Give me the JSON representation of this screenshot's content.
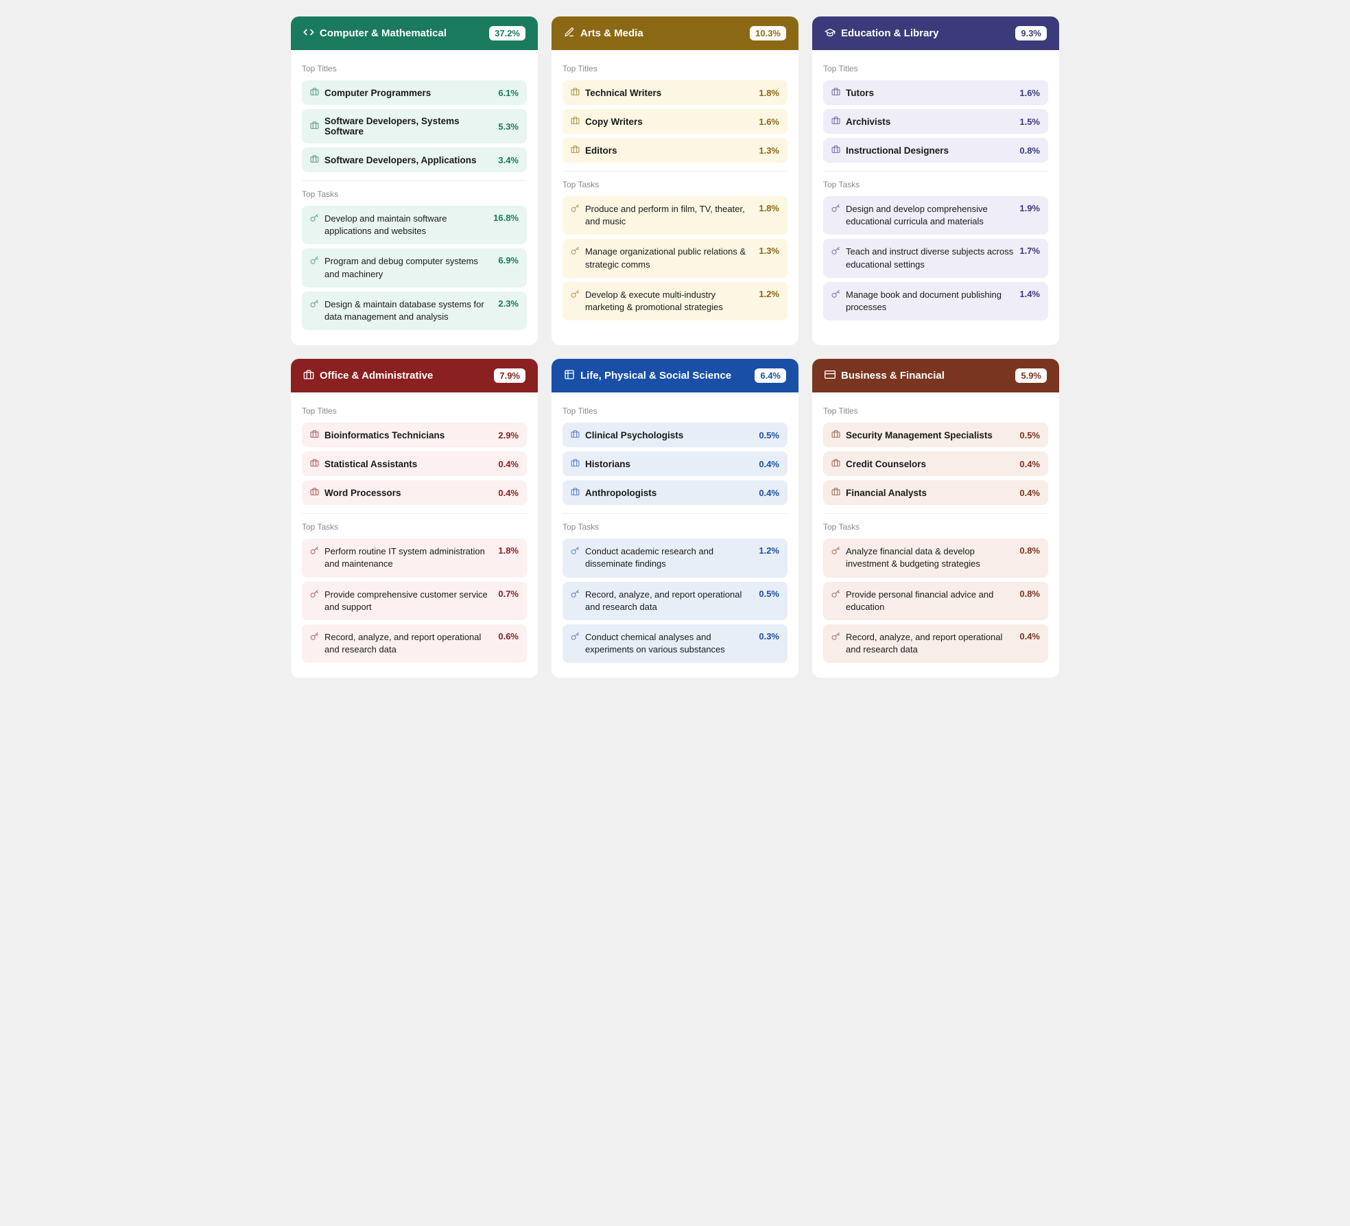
{
  "cards": [
    {
      "id": "computer-mathematical",
      "icon": "</>",
      "title": "Computer & Mathematical",
      "percentage": "37.2%",
      "colorTheme": "green",
      "titles": [
        {
          "name": "Computer Programmers",
          "pct": "6.1%"
        },
        {
          "name": "Software Developers, Systems Software",
          "pct": "5.3%"
        },
        {
          "name": "Software Developers, Applications",
          "pct": "3.4%"
        }
      ],
      "tasks": [
        {
          "text": "Develop and maintain software applications and websites",
          "pct": "16.8%"
        },
        {
          "text": "Program and debug computer systems and machinery",
          "pct": "6.9%"
        },
        {
          "text": "Design & maintain database systems for data management and analysis",
          "pct": "2.3%"
        }
      ]
    },
    {
      "id": "arts-media",
      "icon": "🎨",
      "title": "Arts & Media",
      "percentage": "10.3%",
      "colorTheme": "gold",
      "titles": [
        {
          "name": "Technical Writers",
          "pct": "1.8%"
        },
        {
          "name": "Copy Writers",
          "pct": "1.6%"
        },
        {
          "name": "Editors",
          "pct": "1.3%"
        }
      ],
      "tasks": [
        {
          "text": "Produce and perform in film, TV, theater, and music",
          "pct": "1.8%"
        },
        {
          "text": "Manage organizational public relations & strategic comms",
          "pct": "1.3%"
        },
        {
          "text": "Develop & execute multi-industry marketing & promotional strategies",
          "pct": "1.2%"
        }
      ]
    },
    {
      "id": "education-library",
      "icon": "🎓",
      "title": "Education & Library",
      "percentage": "9.3%",
      "colorTheme": "purple",
      "titles": [
        {
          "name": "Tutors",
          "pct": "1.6%"
        },
        {
          "name": "Archivists",
          "pct": "1.5%"
        },
        {
          "name": "Instructional Designers",
          "pct": "0.8%"
        }
      ],
      "tasks": [
        {
          "text": "Design and develop comprehensive educational curricula and materials",
          "pct": "1.9%"
        },
        {
          "text": "Teach and instruct diverse subjects across educational settings",
          "pct": "1.7%"
        },
        {
          "text": "Manage book and document publishing processes",
          "pct": "1.4%"
        }
      ]
    },
    {
      "id": "office-administrative",
      "icon": "🏢",
      "title": "Office & Administrative",
      "percentage": "7.9%",
      "colorTheme": "red",
      "titles": [
        {
          "name": "Bioinformatics Technicians",
          "pct": "2.9%"
        },
        {
          "name": "Statistical Assistants",
          "pct": "0.4%"
        },
        {
          "name": "Word Processors",
          "pct": "0.4%"
        }
      ],
      "tasks": [
        {
          "text": "Perform routine IT system administration and maintenance",
          "pct": "1.8%"
        },
        {
          "text": "Provide comprehensive customer service and support",
          "pct": "0.7%"
        },
        {
          "text": "Record, analyze, and report operational and research data",
          "pct": "0.6%"
        }
      ]
    },
    {
      "id": "life-physical-social",
      "icon": "🔬",
      "title": "Life, Physical & Social Science",
      "percentage": "6.4%",
      "colorTheme": "blue",
      "titles": [
        {
          "name": "Clinical Psychologists",
          "pct": "0.5%"
        },
        {
          "name": "Historians",
          "pct": "0.4%"
        },
        {
          "name": "Anthropologists",
          "pct": "0.4%"
        }
      ],
      "tasks": [
        {
          "text": "Conduct academic research and disseminate findings",
          "pct": "1.2%"
        },
        {
          "text": "Record, analyze, and report operational and research data",
          "pct": "0.5%"
        },
        {
          "text": "Conduct chemical analyses and experiments on various substances",
          "pct": "0.3%"
        }
      ]
    },
    {
      "id": "business-financial",
      "icon": "📊",
      "title": "Business & Financial",
      "percentage": "5.9%",
      "colorTheme": "brown",
      "titles": [
        {
          "name": "Security Management Specialists",
          "pct": "0.5%"
        },
        {
          "name": "Credit Counselors",
          "pct": "0.4%"
        },
        {
          "name": "Financial Analysts",
          "pct": "0.4%"
        }
      ],
      "tasks": [
        {
          "text": "Analyze financial data & develop investment & budgeting strategies",
          "pct": "0.8%"
        },
        {
          "text": "Provide personal financial advice and education",
          "pct": "0.8%"
        },
        {
          "text": "Record, analyze, and report operational and research data",
          "pct": "0.4%"
        }
      ]
    }
  ],
  "labels": {
    "top_titles": "Top Titles",
    "top_tasks": "Top Tasks"
  }
}
